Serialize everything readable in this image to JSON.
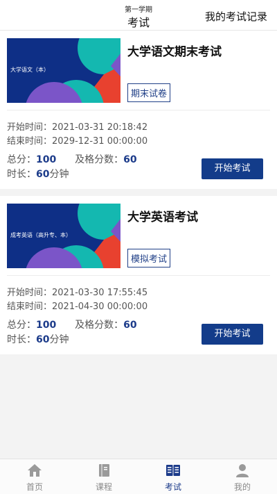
{
  "header": {
    "semester": "第一学期",
    "title": "考试",
    "records_label": "我的考试记录"
  },
  "labels": {
    "start_time": "开始时间：",
    "end_time": "结束时间：",
    "total_score": "总分：",
    "pass_score": "及格分数：",
    "duration": "时长：",
    "minutes": "分钟",
    "start_button": "开始考试"
  },
  "exams": [
    {
      "cover_label": "大学语文（本）",
      "name": "大学语文期末考试",
      "type": "期末试卷",
      "start_time": "2021-03-31 20:18:42",
      "end_time": "2029-12-31 00:00:00",
      "total_score": "100",
      "pass_score": "60",
      "duration": "60"
    },
    {
      "cover_label": "成考英语（高升专、本）",
      "name": "大学英语考试",
      "type": "模拟考试",
      "start_time": "2021-03-30 17:55:45",
      "end_time": "2021-04-30 00:00:00",
      "total_score": "100",
      "pass_score": "60",
      "duration": "60"
    }
  ],
  "tabbar": {
    "items": [
      {
        "label": "首页",
        "icon": "home-icon"
      },
      {
        "label": "课程",
        "icon": "book-icon"
      },
      {
        "label": "考试",
        "icon": "exam-icon",
        "active": true
      },
      {
        "label": "我的",
        "icon": "user-icon"
      }
    ]
  },
  "colors": {
    "primary": "#133c8a",
    "cover_bg": "#0e2f86",
    "cover_teal": "#14b8b0",
    "cover_red": "#e8412f",
    "cover_purple": "#7b55c8",
    "tab_inactive": "#8a8a8a"
  }
}
